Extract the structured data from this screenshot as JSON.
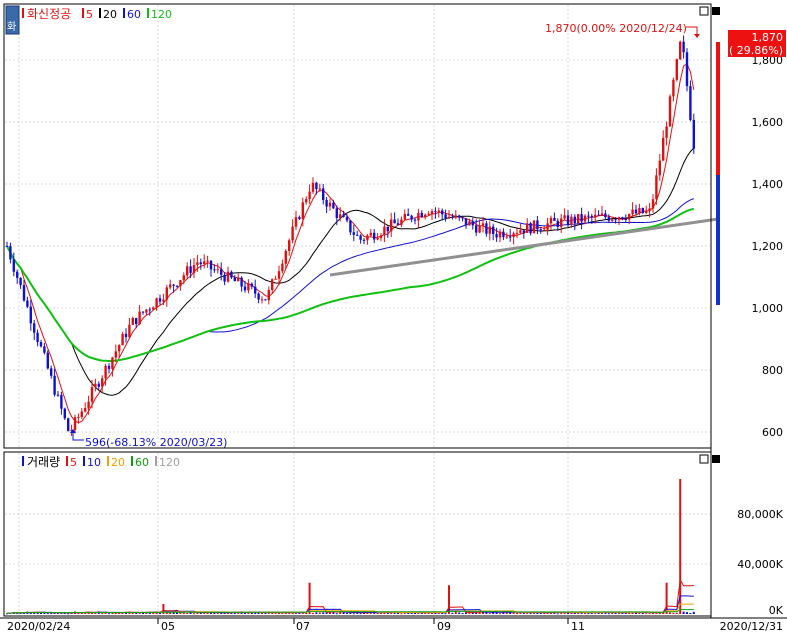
{
  "stock_name": "화신정공",
  "icon_char": "화",
  "price_legend": [
    {
      "label": "5",
      "color": "#e01010"
    },
    {
      "label": "20",
      "color": "#000000"
    },
    {
      "label": "60",
      "color": "#1010d0"
    },
    {
      "label": "120",
      "color": "#10c010"
    }
  ],
  "volume_title": "거래량",
  "volume_legend": [
    {
      "label": "5",
      "color": "#e01010"
    },
    {
      "label": "10",
      "color": "#1010d0"
    },
    {
      "label": "20",
      "color": "#f0a000"
    },
    {
      "label": "60",
      "color": "#10a010"
    },
    {
      "label": "120",
      "color": "#a0a0a0"
    }
  ],
  "price_axis_ticks": [
    "1,800",
    "1,600",
    "1,400",
    "1,200",
    "1,000",
    "800",
    "600"
  ],
  "volume_axis_ticks": [
    "80,000K",
    "40,000K",
    "0K"
  ],
  "x_axis_labels": [
    "2020/02/24",
    "05",
    "07",
    "09",
    "11",
    "2020/12/31"
  ],
  "current_price_tag": {
    "price": "1,870",
    "change": "( 29.86%)"
  },
  "high_annotation": "1,870(0.00% 2020/12/24)",
  "low_annotation": "596(-68.13% 2020/03/23)",
  "chart_data": {
    "type": "candlestick",
    "date_range": [
      "2020/02/24",
      "2020/12/31"
    ],
    "price_ylim": [
      560,
      1880
    ],
    "volume_ylim": [
      0,
      115000
    ],
    "volume_unit": "K",
    "grid": true,
    "price_key_points": [
      {
        "date": "2020/02/24",
        "price": 1200
      },
      {
        "date": "2020/03/23",
        "price": 596
      },
      {
        "date": "2020/04/20",
        "price": 950
      },
      {
        "date": "2020/05/20",
        "price": 1150
      },
      {
        "date": "2020/06/20",
        "price": 1030
      },
      {
        "date": "2020/07/10",
        "price": 1400
      },
      {
        "date": "2020/08/01",
        "price": 1220
      },
      {
        "date": "2020/09/01",
        "price": 1320
      },
      {
        "date": "2020/10/01",
        "price": 1240
      },
      {
        "date": "2020/11/01",
        "price": 1280
      },
      {
        "date": "2020/12/10",
        "price": 1310
      },
      {
        "date": "2020/12/24",
        "price": 1870
      },
      {
        "date": "2020/12/31",
        "price": 1440
      }
    ],
    "volume_key_points": [
      {
        "date": "2020/05/05",
        "volume": 8000
      },
      {
        "date": "2020/07/10",
        "volume": 25000
      },
      {
        "date": "2020/09/10",
        "volume": 23000
      },
      {
        "date": "2020/12/17",
        "volume": 25000
      },
      {
        "date": "2020/12/24",
        "volume": 108000
      }
    ]
  }
}
